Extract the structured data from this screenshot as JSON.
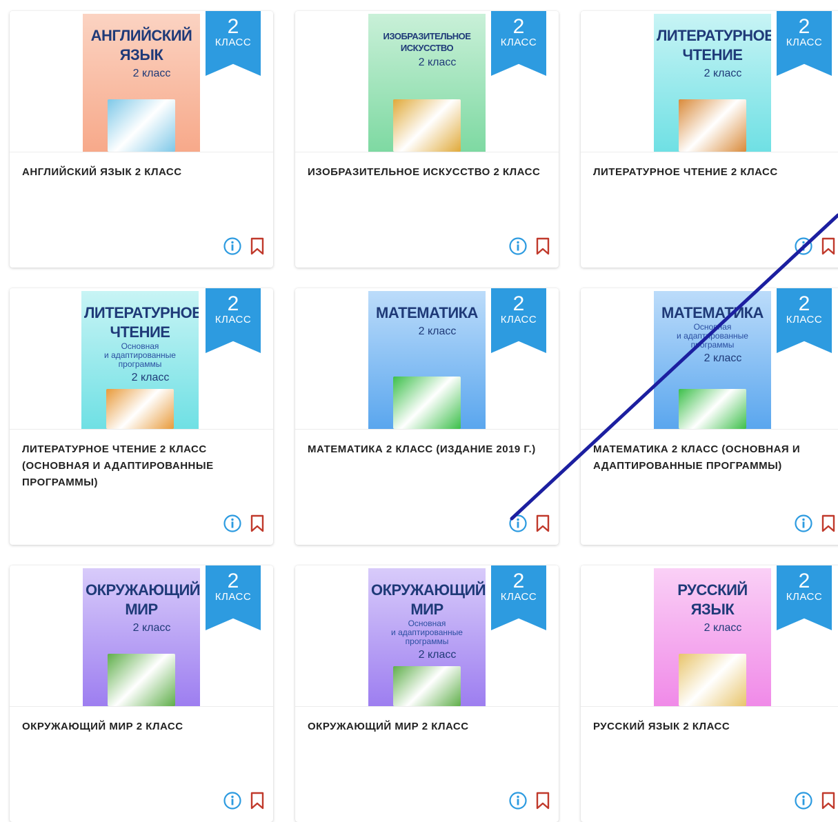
{
  "cards": [
    {
      "title": "АНГЛИЙСКИЙ ЯЗЫК 2 КЛАСС",
      "cover_title": "АНГЛИЙСКИЙ\nЯЗЫК",
      "cover_sub": "",
      "cover_grade": "2 класс",
      "cover_bg": "#f7a98a",
      "cover_bg2": "#fbd3c2",
      "pic_color": "#7ec8e8"
    },
    {
      "title": "ИЗОБРАЗИТЕЛЬНОЕ ИСКУССТВО 2 КЛАСС",
      "cover_title": "ИЗОБРАЗИТЕЛЬНОЕ\nИСКУССТВО",
      "cover_sub": "",
      "cover_grade": "2 класс",
      "cover_bg": "#7ed9a2",
      "cover_bg2": "#c9f0d8",
      "pic_color": "#e0a93a"
    },
    {
      "title": "ЛИТЕРАТУРНОЕ ЧТЕНИЕ 2 КЛАСС",
      "cover_title": "ЛИТЕРАТУРНОЕ\nЧТЕНИЕ",
      "cover_sub": "",
      "cover_grade": "2 класс",
      "cover_bg": "#6fe0e4",
      "cover_bg2": "#c8f4f5",
      "pic_color": "#d98a3a"
    },
    {
      "title": "ЛИТЕРАТУРНОЕ ЧТЕНИЕ 2 КЛАСС (ОСНОВНАЯ И АДАПТИРОВАННЫЕ ПРОГРАММЫ)",
      "cover_title": "ЛИТЕРАТУРНОЕ\nЧТЕНИЕ",
      "cover_sub": "Основная\nи адаптированные\nпрограммы",
      "cover_grade": "2 класс",
      "cover_bg": "#6fe0e4",
      "cover_bg2": "#c8f4f5",
      "pic_color": "#e89a3a"
    },
    {
      "title": "МАТЕМАТИКА 2 КЛАСС (ИЗДАНИЕ 2019 Г.)",
      "cover_title": "МАТЕМАТИКА",
      "cover_sub": "",
      "cover_grade": "2 класс",
      "cover_bg": "#5aa6ee",
      "cover_bg2": "#bcdcfa",
      "pic_color": "#3cbf4a"
    },
    {
      "title": "МАТЕМАТИКА 2 КЛАСС (ОСНОВНАЯ И АДАПТИРОВАННЫЕ ПРОГРАММЫ)",
      "cover_title": "МАТЕМАТИКА",
      "cover_sub": "Основная\nи адаптированные\nпрограммы",
      "cover_grade": "2 класс",
      "cover_bg": "#5aa6ee",
      "cover_bg2": "#bcdcfa",
      "pic_color": "#3cbf4a"
    },
    {
      "title": "ОКРУЖАЮЩИЙ МИР 2 КЛАСС",
      "cover_title": "ОКРУЖАЮЩИЙ\nМИР",
      "cover_sub": "",
      "cover_grade": "2 класс",
      "cover_bg": "#9d7ef0",
      "cover_bg2": "#d8cbfa",
      "pic_color": "#5fae4a"
    },
    {
      "title": "ОКРУЖАЮЩИЙ МИР 2 КЛАСС",
      "cover_title": "ОКРУЖАЮЩИЙ\nМИР",
      "cover_sub": "Основная\nи адаптированные\nпрограммы",
      "cover_grade": "2 класс",
      "cover_bg": "#9d7ef0",
      "cover_bg2": "#d8cbfa",
      "pic_color": "#5fae4a"
    },
    {
      "title": "РУССКИЙ ЯЗЫК 2 КЛАСС",
      "cover_title": "РУССКИЙ\nЯЗЫК",
      "cover_sub": "",
      "cover_grade": "2 класс",
      "cover_bg": "#f08ae8",
      "cover_bg2": "#fad0f6",
      "pic_color": "#e8c46a"
    }
  ],
  "ribbon": {
    "number": "2",
    "label": "КЛАСС"
  },
  "colors": {
    "ribbon": "#2d9be0",
    "info_icon": "#2d9be0",
    "bookmark_icon": "#c0392b",
    "card_title": "#222222"
  },
  "icons": {
    "info": "info-icon",
    "bookmark": "bookmark-icon"
  }
}
